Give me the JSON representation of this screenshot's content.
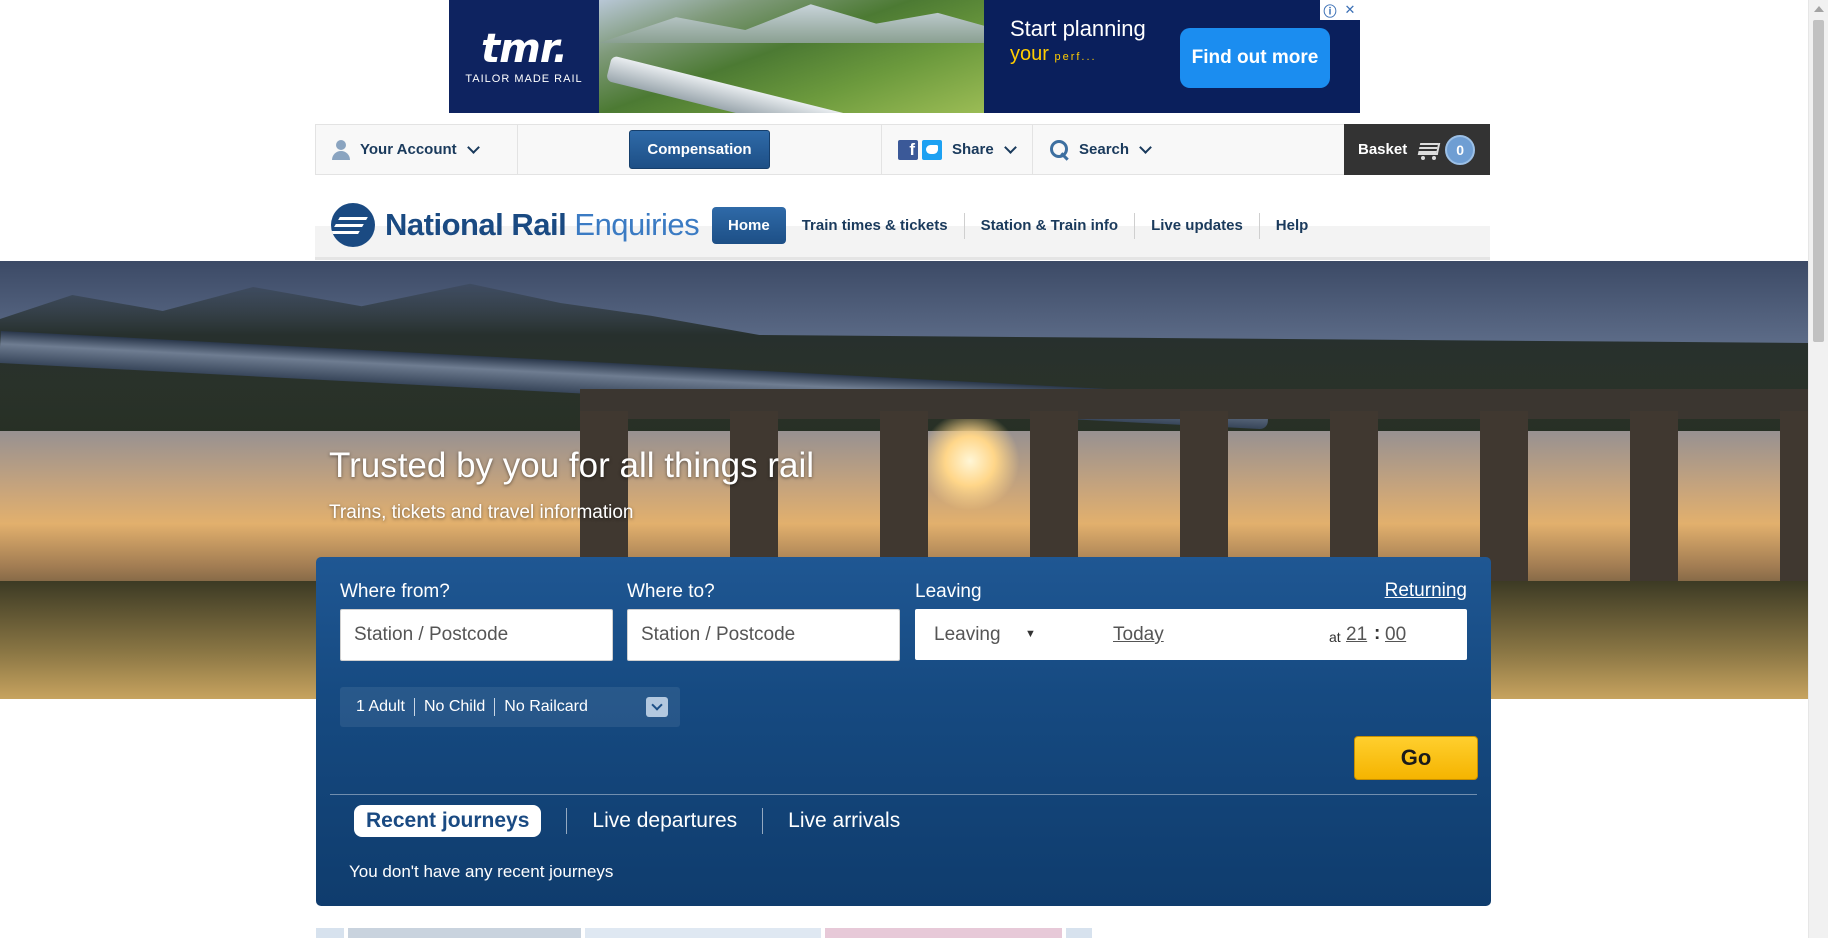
{
  "ad": {
    "logo_main": "tmr.",
    "logo_sub": "TAILOR MADE RAIL",
    "headline": "Start planning",
    "subline_word": "your",
    "subline_fade": "perf...",
    "cta": "Find out more",
    "info_icon": "ⓘ",
    "close_icon": "✕"
  },
  "utility": {
    "account": "Your Account",
    "compensation": "Compensation",
    "share": "Share",
    "search": "Search",
    "basket": "Basket",
    "basket_count": "0"
  },
  "logo": {
    "bold": "National Rail",
    "light": "Enquiries"
  },
  "nav": {
    "items": [
      "Home",
      "Train times & tickets",
      "Station & Train info",
      "Live updates",
      "Help"
    ],
    "active": "Home"
  },
  "hero": {
    "title": "Trusted by you for all things rail",
    "subtitle": "Trains, tickets and travel information"
  },
  "planner": {
    "from_label": "Where from?",
    "from_placeholder": "Station / Postcode",
    "to_label": "Where to?",
    "to_placeholder": "Station / Postcode",
    "leaving_label": "Leaving",
    "returning_label": "Returning",
    "leaving_select": "Leaving",
    "date": "Today",
    "at": "at",
    "hour": "21",
    "minute": "00",
    "passengers": {
      "adults": "1 Adult",
      "children": "No Child",
      "railcard": "No Railcard"
    },
    "go": "Go",
    "tabs": [
      "Recent journeys",
      "Live departures",
      "Live arrivals"
    ],
    "recent_message": "You don't have any recent journeys"
  },
  "colors": {
    "brand_blue": "#1d4f86",
    "go_yellow": "#f5b400",
    "basket_dark": "#333333"
  }
}
